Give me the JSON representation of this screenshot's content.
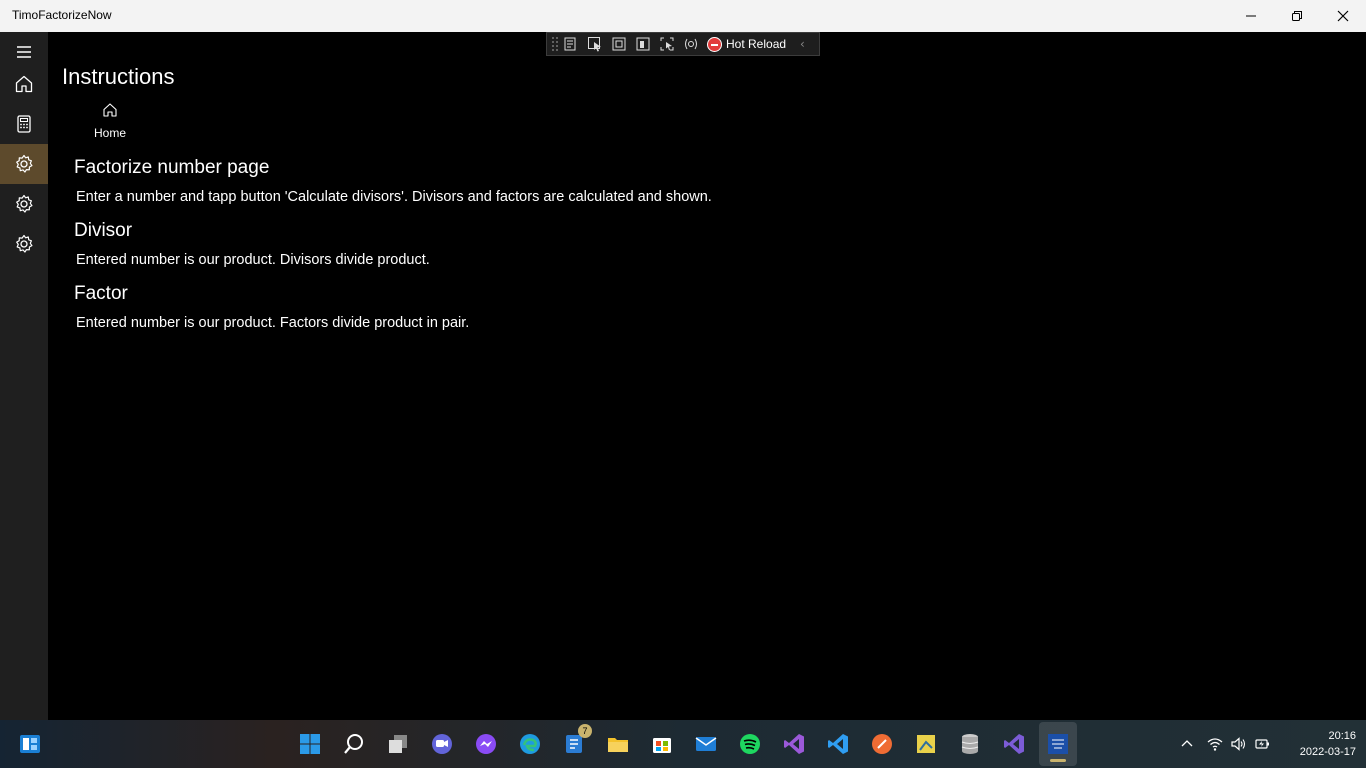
{
  "window": {
    "title": "TimoFactorizeNow"
  },
  "devtoolbar": {
    "hot_reload_label": "Hot Reload"
  },
  "page": {
    "title": "Instructions",
    "home_link_label": "Home",
    "sections": [
      {
        "heading": "Factorize number page",
        "text": "Enter a number and tapp button 'Calculate divisors'. Divisors and factors are calculated and shown."
      },
      {
        "heading": "Divisor",
        "text": "Entered number is our product. Divisors divide product."
      },
      {
        "heading": "Factor",
        "text": "Entered number is our product. Factors divide product in pair."
      }
    ]
  },
  "sidebar": {
    "items": [
      {
        "icon": "hamburger-menu-icon"
      },
      {
        "icon": "home-icon"
      },
      {
        "icon": "calculator-icon"
      },
      {
        "icon": "gear-icon",
        "selected": true
      },
      {
        "icon": "gear-icon"
      },
      {
        "icon": "gear-icon"
      }
    ]
  },
  "taskbar": {
    "icons": [
      "widgets-icon",
      "start-icon",
      "search-icon",
      "task-view-icon",
      "chat-icon",
      "messenger-icon",
      "edge-icon",
      "tasks-icon",
      "file-explorer-icon",
      "store-icon",
      "mail-icon",
      "spotify-icon",
      "visual-studio-icon",
      "vscode-icon",
      "postman-icon",
      "app-icon",
      "database-icon",
      "visual-studio-preview-icon",
      "timo-factorize-now-icon"
    ],
    "badge_count": "7",
    "time": "20:16",
    "date": "2022-03-17"
  },
  "colors": {
    "selected_nav": "#5d4a2c",
    "accent": "#c9b36d"
  }
}
